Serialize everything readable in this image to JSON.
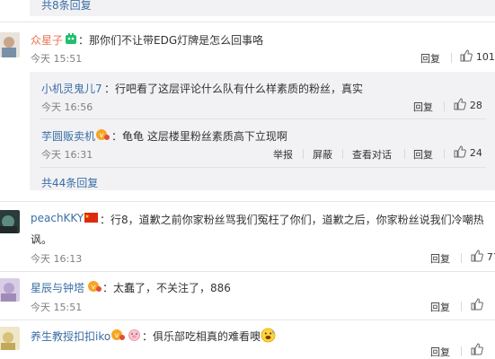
{
  "top": {
    "replies_summary": "共8条回复"
  },
  "comments": [
    {
      "user": "众星子",
      "text": "：那你们不让带EDG灯牌是怎么回事咯",
      "time": "今天 15:51",
      "reply_label": "回复",
      "likes": "101",
      "replies": [
        {
          "user": "小机灵鬼儿7",
          "text": "：行吧看了这层评论什么队有什么样素质的粉丝，真实",
          "time": "今天 16:56",
          "reply_label": "回复",
          "likes": "28"
        },
        {
          "user": "芋圆贩卖机",
          "text": "：龟龟  这层楼里粉丝素质高下立现啊",
          "time": "今天 16:31",
          "report_label": "举报",
          "block_label": "屏蔽",
          "view_dialog_label": "查看对话",
          "reply_label": "回复",
          "likes": "24"
        }
      ],
      "more_replies": "共44条回复"
    },
    {
      "user": "peachKKY",
      "text_line1": "：行8，道歉之前你家粉丝骂我们冤枉了你们，道歉之后，你家粉丝说我们冷嘲热",
      "text_line2": "讽。",
      "time": "今天 16:13",
      "reply_label": "回复",
      "likes": "77"
    },
    {
      "user": "星辰与钟塔",
      "text": "：太蠢了，不关注了，886",
      "time": "今天 15:51",
      "reply_label": "回复",
      "likes": ""
    },
    {
      "user": "养生教授扣扣iko",
      "text": "：俱乐部吃相真的难看噢",
      "time": "",
      "reply_label": "回复",
      "likes": ""
    }
  ],
  "icons": {
    "like": "thumbs-up-icon",
    "vip": "vip-badge-icon",
    "flag": "china-flag-icon",
    "pig": "pig-emoji-icon",
    "emoji": "sweat-smile-emoji-icon"
  },
  "colors": {
    "name_link": "#eb7350",
    "sub_name_link": "#3b6ea5",
    "sub_bg": "#f2f2f5"
  }
}
